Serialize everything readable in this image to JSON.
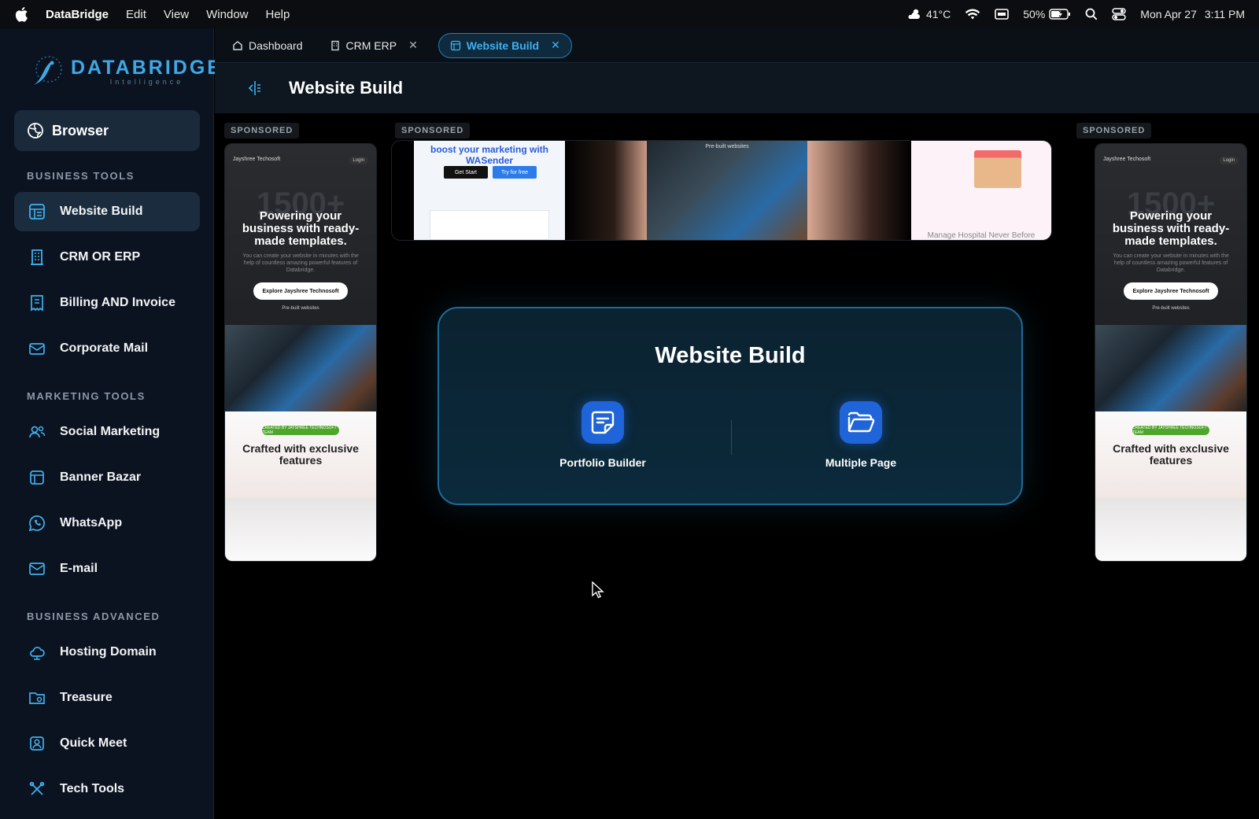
{
  "menubar": {
    "app_name": "DataBridge",
    "items": [
      "Edit",
      "View",
      "Window",
      "Help"
    ],
    "weather": "41°C",
    "battery": "50%",
    "date": "Mon Apr 27",
    "time": "3:11 PM"
  },
  "logo": {
    "name": "DATABRIDGE",
    "tagline": "Intelligence"
  },
  "sidebar": {
    "browser": "Browser",
    "business_tools_title": "BUSINESS TOOLS",
    "business_tools": [
      "Website Build",
      "CRM OR ERP",
      "Billing AND  Invoice",
      "Corporate Mail"
    ],
    "marketing_tools_title": "MARKETING TOOLS",
    "marketing_tools": [
      "Social Marketing",
      "Banner Bazar",
      "WhatsApp",
      "E-mail"
    ],
    "business_advanced_title": "BUSINESS ADVANCED",
    "business_advanced": [
      "Hosting Domain",
      "Treasure",
      "Quick Meet",
      "Tech Tools"
    ],
    "active": "Website Build"
  },
  "tabs": [
    {
      "label": "Dashboard",
      "icon": "home-icon",
      "closable": false,
      "active": false
    },
    {
      "label": "CRM ERP",
      "icon": "building-icon",
      "closable": true,
      "active": false
    },
    {
      "label": "Website Build",
      "icon": "layout-icon",
      "closable": true,
      "active": true
    }
  ],
  "header": {
    "title": "Website Build"
  },
  "ads": {
    "sponsored_label": "SPONSORED",
    "tall": {
      "brand": "Jayshree Techosoft",
      "login": "Login",
      "big_number": "1500+",
      "headline": "Powering your business with ready-made templates.",
      "sub": "You can create your website in minutes with the help of countless amazing powerful features of Databridge.",
      "cta": "Explore Jayshree Technosoft",
      "prebuilt": "Pre-built websites",
      "badge": "CREATED BY JAYSHREE TECHNOSOFT TEAM",
      "crafted": "Crafted with exclusive features"
    },
    "wide": {
      "wasender": "boost your marketing with WASender",
      "get_start": "Get Start",
      "try_free": "Try for free",
      "prebuilt": "Pre-built websites",
      "hospital": "Manage Hospital Never Before"
    }
  },
  "card": {
    "title": "Website Build",
    "options": [
      {
        "label": "Portfolio Builder",
        "icon": "document-icon"
      },
      {
        "label": "Multiple Page",
        "icon": "folder-open-icon"
      }
    ]
  },
  "colors": {
    "accent": "#3fb1f0",
    "card_border": "#1e6c98",
    "icon_bg": "#1f64d8",
    "sidebar_bg": "#0b1320"
  }
}
